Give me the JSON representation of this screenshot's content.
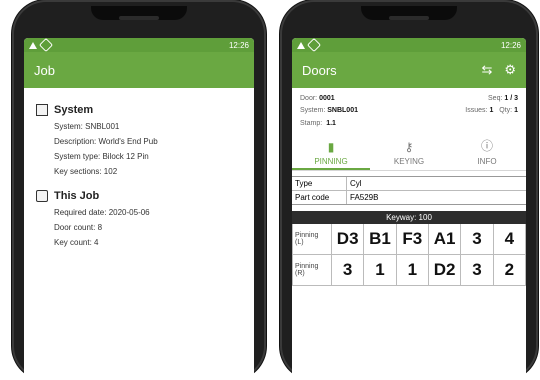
{
  "left": {
    "status_time": "12:26",
    "appbar_title": "Job",
    "system_section_title": "System",
    "system_name": "System: SNBL001",
    "description": "Description: World's End Pub",
    "system_type": "System type: Bilock 12 Pin",
    "key_sections": "Key sections: 102",
    "this_job_title": "This Job",
    "required_date": "Required date: 2020-05-06",
    "door_count": "Door count: 8",
    "key_count": "Key count: 4"
  },
  "right": {
    "status_time": "12:26",
    "appbar_title": "Doors",
    "door_label": "Door:",
    "door_value": "0001",
    "seq_label": "Seq:",
    "seq_value": "1 / 3",
    "system_label": "System:",
    "system_value": "SNBL001",
    "issues_label": "Issues:",
    "issues_value": "1",
    "qty_label": "Qty:",
    "qty_value": "1",
    "stamp_label": "Stamp:",
    "stamp_value": "1.1",
    "tabs": [
      {
        "label": "PINNING"
      },
      {
        "label": "KEYING"
      },
      {
        "label": "INFO"
      }
    ],
    "type_key": "Type",
    "type_value": "Cyl",
    "part_key": "Part code",
    "part_value": "FA529B",
    "keyway_header": "Keyway: 100",
    "pinning_l_label_1": "Pinning",
    "pinning_l_label_2": "(L)",
    "pinning_r_label_1": "Pinning",
    "pinning_r_label_2": "(R)",
    "pinning_l": [
      "D3",
      "B1",
      "F3",
      "A1",
      "3",
      "4"
    ],
    "pinning_r": [
      "3",
      "1",
      "1",
      "D2",
      "3",
      "2"
    ]
  },
  "colors": {
    "primary": "#6aa842",
    "primary_dark": "#5f9e3a",
    "keyway_header_bg": "#2d2d2d"
  }
}
